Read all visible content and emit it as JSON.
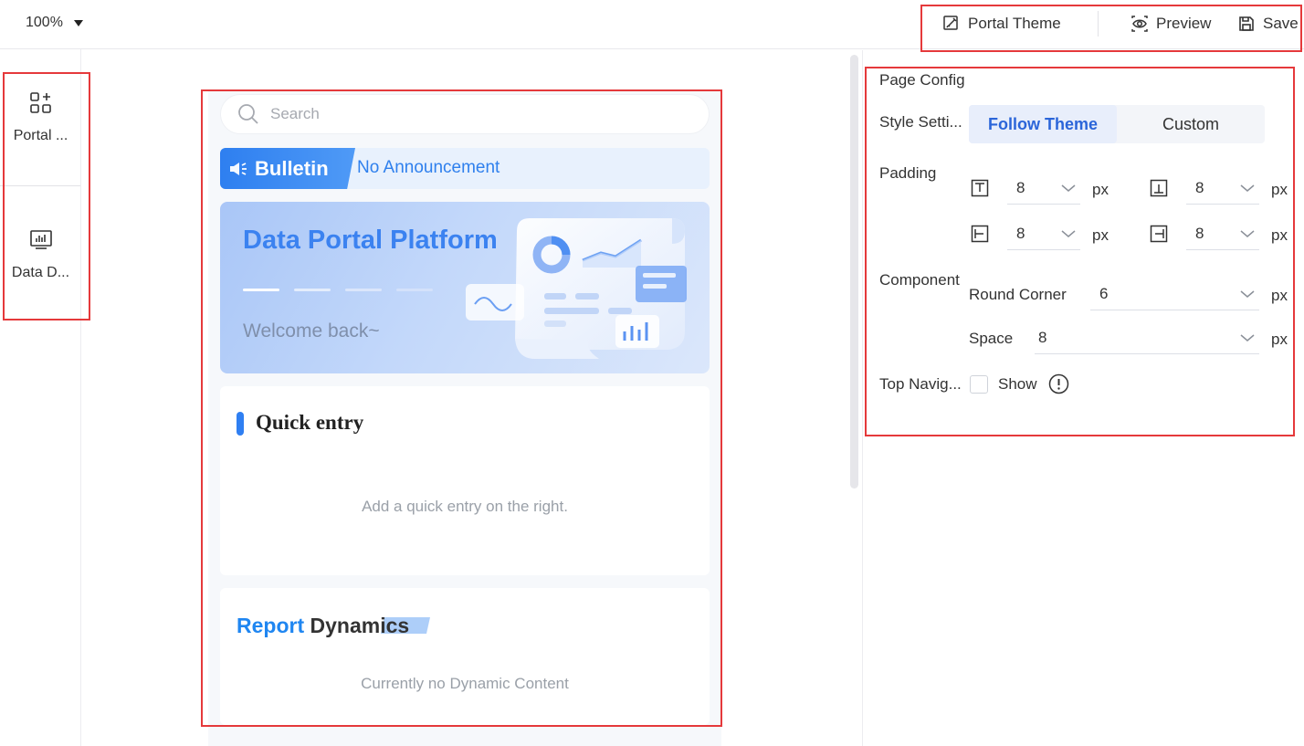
{
  "toolbar": {
    "zoom": "100%",
    "portal_theme": "Portal Theme",
    "preview": "Preview",
    "save": "Save"
  },
  "sidebar": {
    "items": [
      {
        "label": "Portal ...",
        "icon": "widgets-add-icon"
      },
      {
        "label": "Data D...",
        "icon": "dashboard-chart-icon"
      }
    ]
  },
  "preview": {
    "search_placeholder": "Search",
    "bulletin_label": "Bulletin",
    "bulletin_message": "No Announcement",
    "banner_title": "Data Portal Platform",
    "banner_subtitle": "Welcome back~",
    "quick_entry_title": "Quick entry",
    "quick_entry_hint": "Add a quick entry on the right.",
    "report_title_part1": "Report",
    "report_title_part2": "Dynamics",
    "report_hint": "Currently no Dynamic Content"
  },
  "config": {
    "title": "Page Config",
    "style_label": "Style Setti...",
    "style_options": [
      "Follow Theme",
      "Custom"
    ],
    "style_selected": "Follow Theme",
    "padding_label": "Padding",
    "padding_top": "8",
    "padding_bottom": "8",
    "padding_left": "8",
    "padding_right": "8",
    "unit": "px",
    "component_label": "Component",
    "round_corner_label": "Round Corner",
    "round_corner": "6",
    "space_label": "Space",
    "space": "8",
    "top_nav_label": "Top Navig...",
    "top_nav_show": "Show",
    "top_nav_checked": false
  },
  "colors": {
    "accent": "#2f80ed",
    "highlight_border": "#e5393b"
  }
}
